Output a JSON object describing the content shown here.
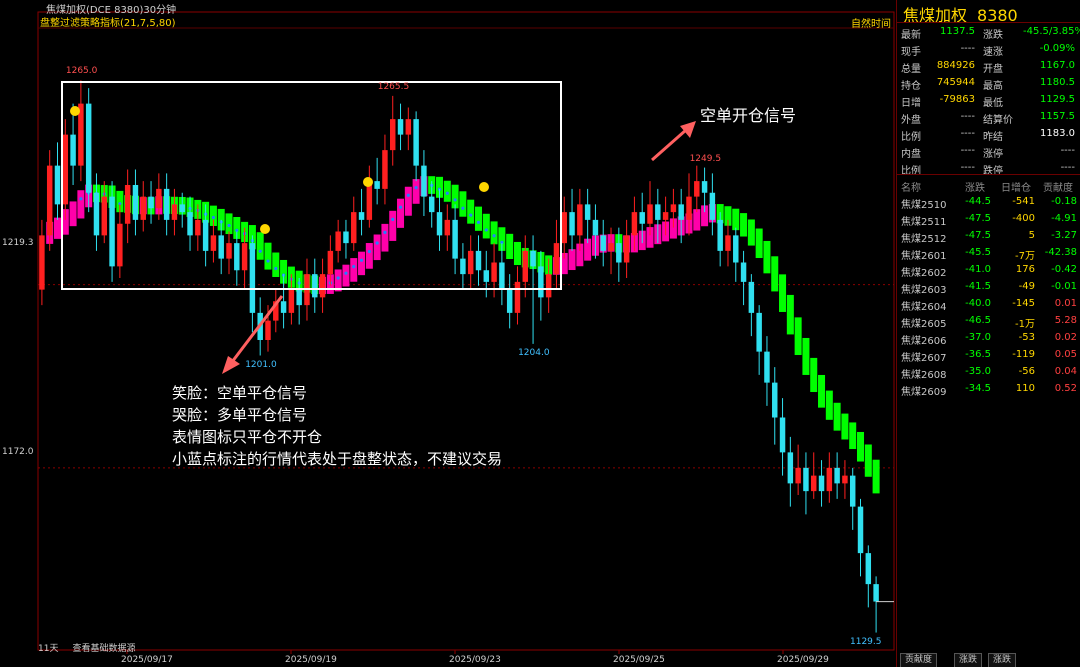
{
  "window_title": "焦煤加权(DCE 8380)30分钟",
  "indicator": {
    "name": "盘整过滤策略指标",
    "params": "(21,7,5,80)"
  },
  "time_mode": "自然时间",
  "y_axis": {
    "levels": [
      "1219.3",
      "1172.0"
    ]
  },
  "chart_data": {
    "type": "candlestick",
    "title": "焦煤加权(DCE 8380)30分钟",
    "x_labels": [
      "2025/09/17",
      "2025/09/19",
      "2025/09/23",
      "2025/09/25",
      "2025/09/29"
    ],
    "y_ticks": [
      1219.3,
      1172.0
    ],
    "ylim": [
      1125,
      1285
    ],
    "candles": [
      [
        1218,
        1232,
        1214,
        1236
      ],
      [
        1232,
        1250,
        1228,
        1254
      ],
      [
        1250,
        1240,
        1236,
        1256
      ],
      [
        1240,
        1258,
        1236,
        1262
      ],
      [
        1258,
        1250,
        1245,
        1266
      ],
      [
        1250,
        1266,
        1246,
        1272
      ],
      [
        1266,
        1243,
        1238,
        1270
      ],
      [
        1243,
        1232,
        1228,
        1248
      ],
      [
        1232,
        1242,
        1230,
        1246
      ],
      [
        1242,
        1224,
        1220,
        1246
      ],
      [
        1224,
        1235,
        1221,
        1240
      ],
      [
        1235,
        1245,
        1230,
        1249
      ],
      [
        1245,
        1236,
        1232,
        1249
      ],
      [
        1236,
        1242,
        1233,
        1246
      ],
      [
        1242,
        1239,
        1235,
        1246
      ],
      [
        1239,
        1244,
        1236,
        1248
      ],
      [
        1244,
        1236,
        1232,
        1248
      ],
      [
        1236,
        1240,
        1232,
        1244
      ],
      [
        1240,
        1238,
        1234,
        1243
      ],
      [
        1238,
        1232,
        1228,
        1242
      ],
      [
        1232,
        1236,
        1228,
        1240
      ],
      [
        1236,
        1228,
        1224,
        1240
      ],
      [
        1228,
        1232,
        1225,
        1236
      ],
      [
        1232,
        1226,
        1222,
        1236
      ],
      [
        1226,
        1230,
        1222,
        1233
      ],
      [
        1230,
        1223,
        1219,
        1233
      ],
      [
        1223,
        1230,
        1218,
        1234
      ],
      [
        1230,
        1212,
        1207,
        1232
      ],
      [
        1212,
        1205,
        1201,
        1216
      ],
      [
        1205,
        1210,
        1202,
        1214
      ],
      [
        1210,
        1215,
        1207,
        1218
      ],
      [
        1215,
        1212,
        1208,
        1222
      ],
      [
        1212,
        1218,
        1209,
        1222
      ],
      [
        1218,
        1214,
        1209,
        1221
      ],
      [
        1214,
        1222,
        1210,
        1226
      ],
      [
        1222,
        1216,
        1212,
        1226
      ],
      [
        1216,
        1222,
        1212,
        1226
      ],
      [
        1222,
        1228,
        1219,
        1232
      ],
      [
        1228,
        1233,
        1225,
        1236
      ],
      [
        1233,
        1230,
        1226,
        1236
      ],
      [
        1230,
        1238,
        1228,
        1242
      ],
      [
        1238,
        1236,
        1232,
        1244
      ],
      [
        1236,
        1246,
        1234,
        1250
      ],
      [
        1246,
        1244,
        1240,
        1252
      ],
      [
        1244,
        1254,
        1240,
        1258
      ],
      [
        1254,
        1262,
        1250,
        1268
      ],
      [
        1262,
        1258,
        1254,
        1266
      ],
      [
        1258,
        1262,
        1254,
        1265
      ],
      [
        1262,
        1250,
        1246,
        1264
      ],
      [
        1250,
        1242,
        1237,
        1254
      ],
      [
        1242,
        1238,
        1234,
        1246
      ],
      [
        1238,
        1232,
        1228,
        1244
      ],
      [
        1232,
        1236,
        1228,
        1240
      ],
      [
        1236,
        1226,
        1222,
        1240
      ],
      [
        1226,
        1222,
        1218,
        1230
      ],
      [
        1222,
        1228,
        1218,
        1232
      ],
      [
        1228,
        1223,
        1219,
        1232
      ],
      [
        1223,
        1220,
        1216,
        1228
      ],
      [
        1220,
        1225,
        1216,
        1230
      ],
      [
        1225,
        1218,
        1214,
        1230
      ],
      [
        1218,
        1212,
        1208,
        1222
      ],
      [
        1212,
        1220,
        1209,
        1224
      ],
      [
        1220,
        1228,
        1216,
        1232
      ],
      [
        1228,
        1224,
        1204,
        1232
      ],
      [
        1224,
        1216,
        1210,
        1228
      ],
      [
        1216,
        1222,
        1212,
        1226
      ],
      [
        1222,
        1230,
        1218,
        1236
      ],
      [
        1230,
        1238,
        1226,
        1242
      ],
      [
        1238,
        1232,
        1228,
        1244
      ],
      [
        1232,
        1240,
        1228,
        1244
      ],
      [
        1240,
        1236,
        1230,
        1244
      ],
      [
        1236,
        1232,
        1226,
        1240
      ],
      [
        1232,
        1228,
        1224,
        1236
      ],
      [
        1228,
        1230,
        1222,
        1234
      ],
      [
        1230,
        1225,
        1220,
        1234
      ],
      [
        1225,
        1232,
        1221,
        1236
      ],
      [
        1232,
        1238,
        1228,
        1242
      ],
      [
        1238,
        1235,
        1230,
        1243
      ],
      [
        1235,
        1240,
        1232,
        1246
      ],
      [
        1240,
        1236,
        1230,
        1244
      ],
      [
        1236,
        1238,
        1232,
        1242
      ],
      [
        1238,
        1240,
        1234,
        1244
      ],
      [
        1240,
        1236,
        1230,
        1244
      ],
      [
        1236,
        1242,
        1232,
        1248
      ],
      [
        1242,
        1246,
        1238,
        1250
      ],
      [
        1246,
        1243,
        1238,
        1249.5
      ],
      [
        1243,
        1236,
        1232,
        1248
      ],
      [
        1236,
        1228,
        1224,
        1238
      ],
      [
        1228,
        1232,
        1224,
        1236
      ],
      [
        1232,
        1225,
        1220,
        1234
      ],
      [
        1225,
        1220,
        1214,
        1228
      ],
      [
        1220,
        1212,
        1206,
        1222
      ],
      [
        1212,
        1202,
        1196,
        1214
      ],
      [
        1202,
        1194,
        1188,
        1206
      ],
      [
        1194,
        1185,
        1178,
        1198
      ],
      [
        1185,
        1176,
        1170,
        1190
      ],
      [
        1176,
        1168,
        1162,
        1180
      ],
      [
        1168,
        1172,
        1165,
        1178
      ],
      [
        1172,
        1166,
        1160,
        1176
      ],
      [
        1166,
        1170,
        1164,
        1176
      ],
      [
        1170,
        1166,
        1162,
        1174
      ],
      [
        1166,
        1172,
        1163,
        1176
      ],
      [
        1172,
        1168,
        1164,
        1176
      ],
      [
        1168,
        1170,
        1164,
        1174
      ],
      [
        1170,
        1162,
        1156,
        1172
      ],
      [
        1162,
        1150,
        1144,
        1164
      ],
      [
        1150,
        1142,
        1136,
        1152
      ],
      [
        1142,
        1137.5,
        1129.5,
        1144
      ]
    ],
    "price_labels": [
      {
        "text": "1265.0",
        "color": "#ff5050",
        "kind": "high",
        "index": 5
      },
      {
        "text": "1265.5",
        "color": "#ff5050",
        "kind": "high",
        "index": 45
      },
      {
        "text": "1249.5",
        "color": "#ff5050",
        "kind": "high",
        "index": 85
      },
      {
        "text": "1201.0",
        "color": "#40c0ff",
        "kind": "low",
        "index": 28
      },
      {
        "text": "1204.0",
        "color": "#40c0ff",
        "kind": "low",
        "index": 63
      },
      {
        "text": "1129.5",
        "color": "#40c0ff",
        "kind": "low",
        "index": 107
      }
    ],
    "current_price": 1137.5
  },
  "annotations": {
    "open_signal": "空单开仓信号",
    "legend_lines": [
      "笑脸：空单平仓信号",
      "哭脸：多单平仓信号",
      "表情图标只平仓不开仓",
      "小蓝点标注的行情代表处于盘整状态，不建议交易"
    ]
  },
  "bottom": {
    "days": "11天",
    "link": "查看基础数据源"
  },
  "panel": {
    "title": "焦煤加权",
    "code": "8380",
    "quote": [
      {
        "l": "最新",
        "v": "1137.5",
        "vc": "#00ff00",
        "l2": "涨跌",
        "v2": "-45.5/3.85%",
        "v2c": "#00ff00"
      },
      {
        "l": "现手",
        "v": "----",
        "vc": "#c8c8c8",
        "l2": "速涨",
        "v2": "-0.09%",
        "v2c": "#00ff00"
      },
      {
        "l": "总量",
        "v": "884926",
        "vc": "#ffd700",
        "l2": "开盘",
        "v2": "1167.0",
        "v2c": "#00ff00"
      },
      {
        "l": "持仓",
        "v": "745944",
        "vc": "#ffd700",
        "l2": "最高",
        "v2": "1180.5",
        "v2c": "#00ff00"
      },
      {
        "l": "日增",
        "v": "-79863",
        "vc": "#ffd700",
        "l2": "最低",
        "v2": "1129.5",
        "v2c": "#00ff00"
      },
      {
        "l": "外盘",
        "v": "----",
        "vc": "#c8c8c8",
        "l2": "结算价",
        "v2": "1157.5",
        "v2c": "#00ff00"
      },
      {
        "l": "比例",
        "v": "----",
        "vc": "#c8c8c8",
        "l2": "昨结",
        "v2": "1183.0",
        "v2c": "#ffffff"
      },
      {
        "l": "内盘",
        "v": "----",
        "vc": "#c8c8c8",
        "l2": "涨停",
        "v2": "----",
        "v2c": "#c8c8c8"
      },
      {
        "l": "比例",
        "v": "----",
        "vc": "#c8c8c8",
        "l2": "跌停",
        "v2": "----",
        "v2c": "#c8c8c8"
      }
    ],
    "list_header": [
      "名称",
      "涨跌",
      "日增仓",
      "贡献度"
    ],
    "list": [
      {
        "n": "焦煤2510",
        "c": "-44.5",
        "o": "-541",
        "g": "-0.18",
        "oc": "#ffd700",
        "gc": "#00ff00"
      },
      {
        "n": "焦煤2511",
        "c": "-47.5",
        "o": "-400",
        "g": "-4.91",
        "oc": "#ffd700",
        "gc": "#00ff00"
      },
      {
        "n": "焦煤2512",
        "c": "-47.5",
        "o": "5",
        "g": "-3.27",
        "oc": "#ffd700",
        "gc": "#00ff00"
      },
      {
        "n": "焦煤2601",
        "c": "-45.5",
        "o": "-7万",
        "g": "-42.38",
        "oc": "#ffd700",
        "gc": "#00ff00"
      },
      {
        "n": "焦煤2602",
        "c": "-41.0",
        "o": "176",
        "g": "-0.42",
        "oc": "#ffd700",
        "gc": "#00ff00"
      },
      {
        "n": "焦煤2603",
        "c": "-41.5",
        "o": "-49",
        "g": "-0.01",
        "oc": "#ffd700",
        "gc": "#00ff00"
      },
      {
        "n": "焦煤2604",
        "c": "-40.0",
        "o": "-145",
        "g": "0.01",
        "oc": "#ffd700",
        "gc": "#ff4040"
      },
      {
        "n": "焦煤2605",
        "c": "-46.5",
        "o": "-1万",
        "g": "5.28",
        "oc": "#ffd700",
        "gc": "#ff4040"
      },
      {
        "n": "焦煤2606",
        "c": "-37.0",
        "o": "-53",
        "g": "0.02",
        "oc": "#ffd700",
        "gc": "#ff4040"
      },
      {
        "n": "焦煤2607",
        "c": "-36.5",
        "o": "-119",
        "g": "0.05",
        "oc": "#ffd700",
        "gc": "#ff4040"
      },
      {
        "n": "焦煤2608",
        "c": "-35.0",
        "o": "-56",
        "g": "0.04",
        "oc": "#ffd700",
        "gc": "#ff4040"
      },
      {
        "n": "焦煤2609",
        "c": "-34.5",
        "o": "110",
        "g": "0.52",
        "oc": "#ffd700",
        "gc": "#ff4040"
      }
    ],
    "tabs": [
      "贡献度",
      "涨跌",
      "涨跌"
    ]
  },
  "colors": {
    "up": "#ff2020",
    "down": "#30e0f0",
    "bull_band": "#00ff00",
    "bear_band": "#ff00aa",
    "consolidation": "#2080ff",
    "box": "#ffffff",
    "arrow": "#ff6060",
    "smile": "#ffd700"
  }
}
